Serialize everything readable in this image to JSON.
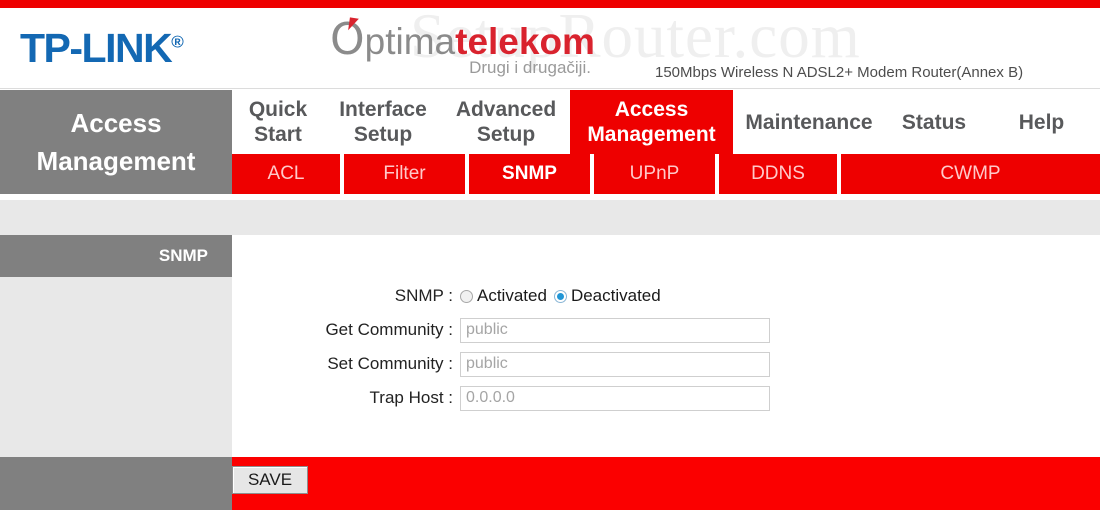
{
  "header": {
    "brand_logo": "TP-LINK",
    "brand_registered": "®",
    "isp_logo_grey": "ptima",
    "isp_logo_red": "telekom",
    "isp_tagline": "Drugi i drugačiji.",
    "model_text": "150Mbps Wireless N ADSL2+ Modem Router(Annex B)",
    "watermark": "SetupRouter.com"
  },
  "nav": {
    "section_label": "Access\nManagement",
    "main_tabs": [
      {
        "label": "Quick\nStart",
        "active": false
      },
      {
        "label": "Interface\nSetup",
        "active": false
      },
      {
        "label": "Advanced\nSetup",
        "active": false
      },
      {
        "label": "Access\nManagement",
        "active": true
      },
      {
        "label": "Maintenance",
        "active": false
      },
      {
        "label": "Status",
        "active": false
      },
      {
        "label": "Help",
        "active": false
      }
    ],
    "sub_tabs": [
      {
        "label": "ACL",
        "active": false
      },
      {
        "label": "Filter",
        "active": false
      },
      {
        "label": "SNMP",
        "active": true
      },
      {
        "label": "UPnP",
        "active": false
      },
      {
        "label": "DDNS",
        "active": false
      },
      {
        "label": "CWMP",
        "active": false
      }
    ]
  },
  "content": {
    "section_title": "SNMP",
    "fields": {
      "snmp_label": "SNMP :",
      "snmp_option_activated": "Activated",
      "snmp_option_deactivated": "Deactivated",
      "snmp_selected": "Deactivated",
      "get_community_label": "Get Community :",
      "get_community_value": "public",
      "set_community_label": "Set Community :",
      "set_community_value": "public",
      "trap_host_label": "Trap Host :",
      "trap_host_value": "0.0.0.0"
    }
  },
  "footer": {
    "save_label": "SAVE"
  },
  "colors": {
    "red": "#ee0000",
    "footer_red": "#fb0000",
    "grey": "#808080",
    "light_grey": "#e8e8e8",
    "tplink_blue": "#1368b3",
    "optima_red": "#d9232e",
    "radio_blue": "#2196d6"
  }
}
